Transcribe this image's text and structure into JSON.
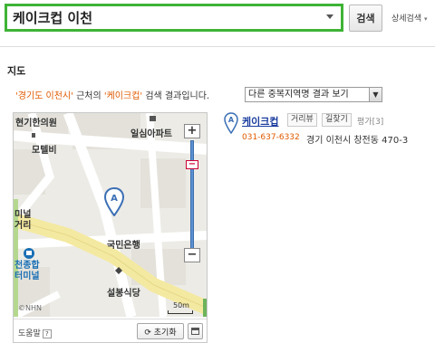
{
  "search": {
    "value": "케이크컵 이천",
    "button_label": "검색",
    "advanced_label": "상세검색",
    "colors": {
      "border": "#3eb335"
    }
  },
  "section": {
    "title": "지도"
  },
  "summary": {
    "region": "'경기도 이천시'",
    "text_middle": " 근처의 ",
    "keyword": "'케이크컵'",
    "text_end": " 검색 결과입니다.",
    "dropdown_value": "다른 중복지역명 결과 보기"
  },
  "map": {
    "labels": {
      "clinic": "현기한의원",
      "apartment": "일심아파트",
      "motel": "모텔비",
      "district": "미널\n거리",
      "bank": "국민은행",
      "terminal": "천종합\n터미널",
      "restaurant": "설봉식당"
    },
    "marker_letter": "A",
    "copyright": "©NHN",
    "scale_label": "50m",
    "zoom_in": "+",
    "zoom_out": "−",
    "toolbar": {
      "help_label": "도움말",
      "help_badge": "?",
      "reset_label": "초기화",
      "reset_icon": "refresh-icon"
    }
  },
  "result": {
    "marker_letter": "A",
    "name": "케이크컵",
    "buttons": [
      "거리뷰",
      "길찾기"
    ],
    "rating_label": "평가",
    "rating_count": "[3]",
    "phone": "031-637-6332",
    "address": "경기 이천시 창전동 470-3",
    "colors": {
      "name": "#1a3d9e",
      "phone": "#e05a00"
    }
  }
}
